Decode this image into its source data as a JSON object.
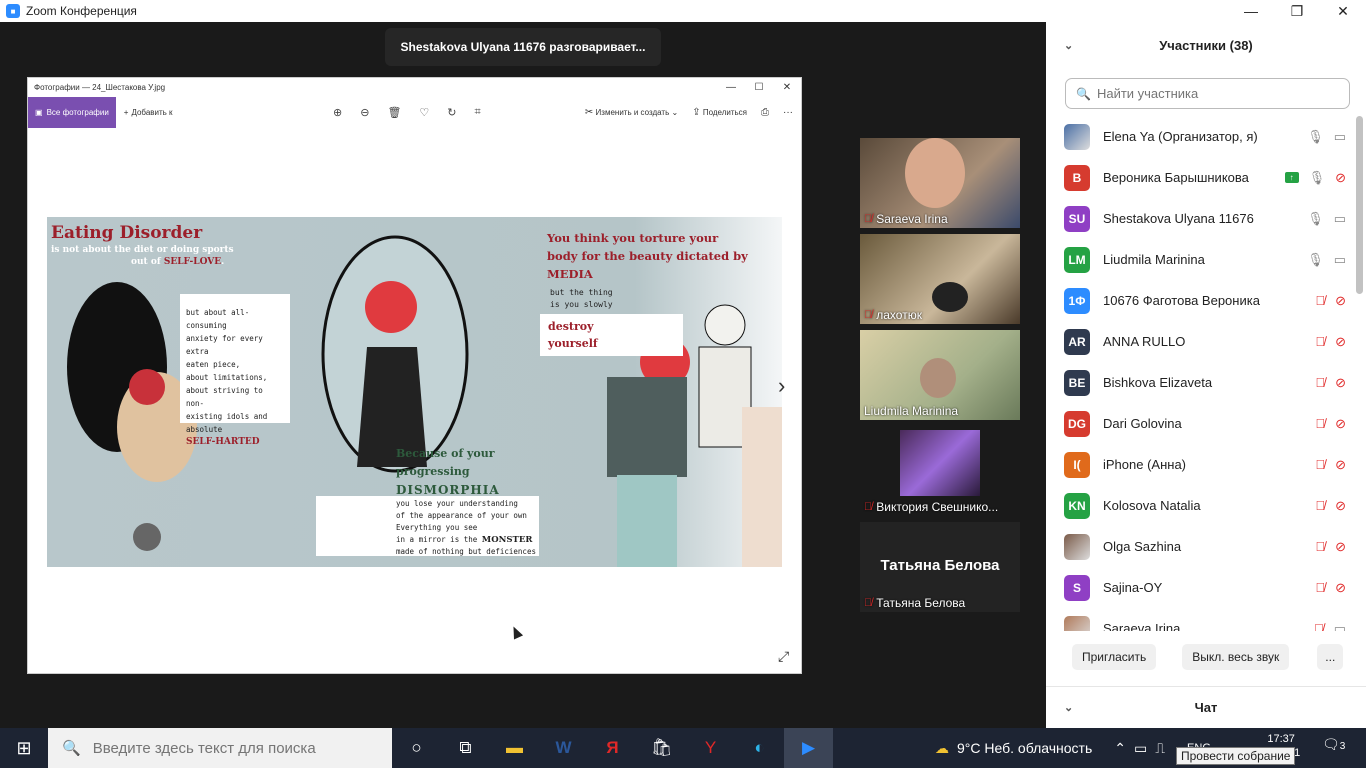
{
  "window": {
    "title": "Zoom Конференция"
  },
  "speaker": {
    "text": "Shestakova Ulyana 11676 разговаривает..."
  },
  "photos": {
    "title": "Фотографии — 24_Шестакова У.jpg",
    "all_photos": "Все фотографии",
    "add_to": "Добавить к",
    "edit_create": "Изменить и создать",
    "share": "Поделиться"
  },
  "poster": {
    "title": "Eating Disorder",
    "line1": "is not about the diet or doing sports",
    "line2a": "out of ",
    "line2b": "SELF-LOVE",
    "line2c": ".",
    "box1": [
      "but about all-consuming",
      "anxiety for every extra",
      "eaten  piece,",
      "about limitations,",
      "about striving to non-",
      "existing idols and",
      "absolute"
    ],
    "box1_red": "SELF-HARTED",
    "right_title": [
      "You think you torture your",
      "body for the beauty dictated by",
      "MEDIA"
    ],
    "right_sub": [
      "but the thing",
      "is you slowly"
    ],
    "right_box": [
      "destroy",
      "yourself"
    ],
    "mid_title": [
      "Because of your",
      "progressing"
    ],
    "mid_big": "DISMORPHIA",
    "mid_box": [
      "you lose your understanding",
      "of the appearance of your own",
      "Everything you see"
    ],
    "mid_box_a": "in a mirror is the ",
    "mid_box_b": "MONSTER",
    "mid_box_last": "made of nothing but deficiences"
  },
  "tiles": [
    {
      "name": "Saraeva Irina",
      "muted": true
    },
    {
      "name": "лахотюк",
      "muted": true
    },
    {
      "name": "Liudmila Marinina",
      "muted": false
    },
    {
      "name": "Виктория Свешнико...",
      "muted": true
    },
    {
      "name": "Татьяна Белова",
      "muted": true,
      "big": "Татьяна Белова"
    }
  ],
  "panel": {
    "title": "Участники (38)",
    "search_placeholder": "Найти участника",
    "participants": [
      {
        "initials": "",
        "name": "Elena Ya (Организатор, я)",
        "color": "#4a6fa5",
        "mic": "on",
        "cam": "on",
        "photo": true
      },
      {
        "initials": "В",
        "name": "Вероника Барышникова",
        "color": "#d63b2f",
        "mic": "on",
        "cam": "off",
        "share": true
      },
      {
        "initials": "SU",
        "name": "Shestakova Ulyana 11676",
        "color": "#8f3fc4",
        "mic": "on",
        "cam": "on"
      },
      {
        "initials": "LM",
        "name": "Liudmila Marinina",
        "color": "#25a244",
        "mic": "on",
        "cam": "on"
      },
      {
        "initials": "1Ф",
        "name": "10676 Фаготова Вероника",
        "color": "#2d8cff",
        "mic": "off",
        "cam": "off"
      },
      {
        "initials": "AR",
        "name": "ANNA RULLO",
        "color": "#2f3a4f",
        "mic": "off",
        "cam": "off"
      },
      {
        "initials": "BE",
        "name": "Bishkova Elizaveta",
        "color": "#2f3a4f",
        "mic": "off",
        "cam": "off"
      },
      {
        "initials": "DG",
        "name": "Dari Golovina",
        "color": "#d63b2f",
        "mic": "off",
        "cam": "off"
      },
      {
        "initials": "I(",
        "name": "iPhone (Анна)",
        "color": "#e06a1b",
        "mic": "off",
        "cam": "off"
      },
      {
        "initials": "KN",
        "name": "Kolosova Natalia",
        "color": "#25a244",
        "mic": "off",
        "cam": "off"
      },
      {
        "initials": "",
        "name": "Olga Sazhina",
        "color": "#7a5a48",
        "mic": "off",
        "cam": "off",
        "photo": true
      },
      {
        "initials": "S",
        "name": "Sajina-OY",
        "color": "#8f3fc4",
        "mic": "off",
        "cam": "off"
      },
      {
        "initials": "",
        "name": "Saraeva Irina",
        "color": "#b07a5a",
        "mic": "off",
        "cam": "on",
        "photo": true
      }
    ],
    "invite": "Пригласить",
    "mute_all": "Выкл. весь звук",
    "more": "...",
    "chat": "Чат"
  },
  "taskbar": {
    "search_placeholder": "Введите здесь текст для поиска",
    "weather": "9°C  Неб. облачность",
    "time": "17:37",
    "date_partial": "21",
    "lang": "ENG",
    "notifications": "3",
    "tooltip": "Провести собрание"
  },
  "colors": {
    "accent": "#7a4fb0",
    "zoom_blue": "#2d8cff",
    "muted_red": "#e02828"
  }
}
